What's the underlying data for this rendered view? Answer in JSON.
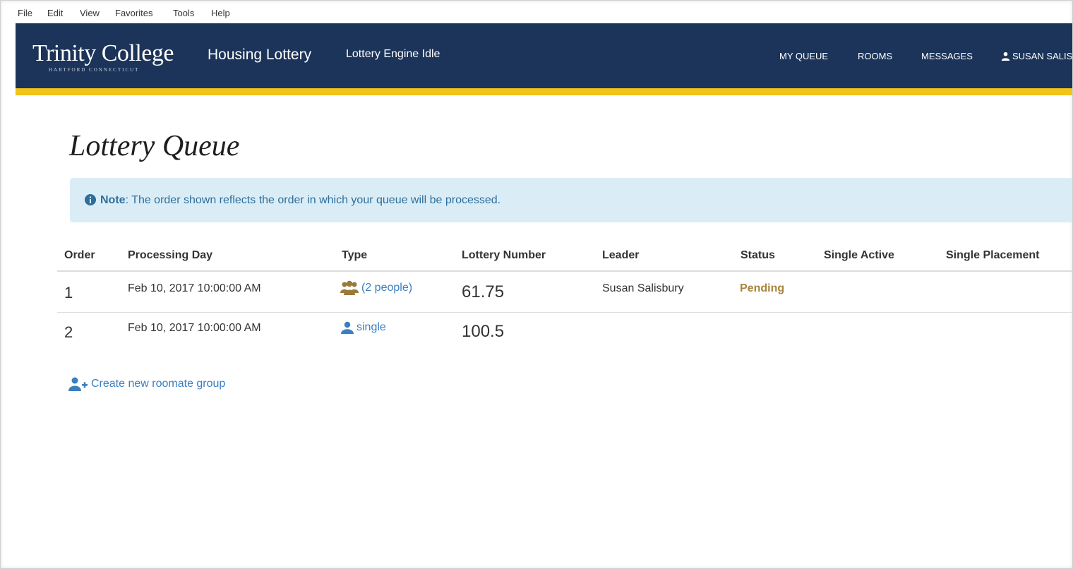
{
  "browser_menu": {
    "items": [
      "File",
      "Edit",
      "View",
      "Favorites",
      "Tools",
      "Help"
    ]
  },
  "header": {
    "logo_text": "Trinity College",
    "logo_subtext": "HARTFORD CONNECTICUT",
    "app_title": "Housing Lottery",
    "engine_status": "Lottery Engine Idle",
    "nav": {
      "my_queue": "MY QUEUE",
      "rooms": "ROOMS",
      "messages": "MESSAGES",
      "user": "SUSAN SALIS"
    },
    "colors": {
      "header_bg": "#1c3459",
      "accent_bar": "#f2c318"
    }
  },
  "page": {
    "title": "Lottery Queue",
    "note_label": "Note",
    "note_text": ": The order shown reflects the order in which your queue will be processed."
  },
  "table": {
    "headers": {
      "order": "Order",
      "processing_day": "Processing Day",
      "type": "Type",
      "lottery_number": "Lottery Number",
      "leader": "Leader",
      "status": "Status",
      "single_active": "Single Active",
      "single_placement": "Single Placement"
    },
    "rows": [
      {
        "order": "1",
        "processing_day": "Feb 10, 2017 10:00:00 AM",
        "type_icon": "group-icon",
        "type_label": "(2 people)",
        "lottery_number": "61.75",
        "leader": "Susan Salisbury",
        "status": "Pending",
        "single_active": "",
        "single_placement": ""
      },
      {
        "order": "2",
        "processing_day": "Feb 10, 2017 10:00:00 AM",
        "type_icon": "user-icon",
        "type_label": "single",
        "lottery_number": "100.5",
        "leader": "",
        "status": "",
        "single_active": "",
        "single_placement": ""
      }
    ]
  },
  "actions": {
    "create_group": "Create new roomate group"
  }
}
